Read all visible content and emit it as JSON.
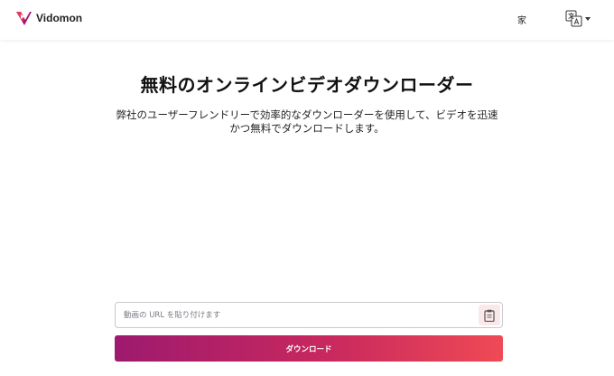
{
  "header": {
    "brand": "Vidomon",
    "nav_home": "家",
    "lang_icon": "translate-icon",
    "logo_colors": [
      "#e53a5a",
      "#a0196f"
    ]
  },
  "hero": {
    "title": "無料のオンラインビデオダウンローダー",
    "description_line1": "弊社のユーザーフレンドリーで効率的なダウンローダーを使用して、ビデオを迅速",
    "description_line2": "かつ無料でダウンロードします。"
  },
  "form": {
    "url_placeholder": "動画の URL を貼り付けます",
    "url_value": "",
    "paste_icon": "clipboard-icon",
    "download_label": "ダウンロード"
  },
  "colors": {
    "button_gradient_start": "#9e1a6e",
    "button_gradient_end": "#ef4a55",
    "paste_button_bg": "#fbe9ea"
  }
}
